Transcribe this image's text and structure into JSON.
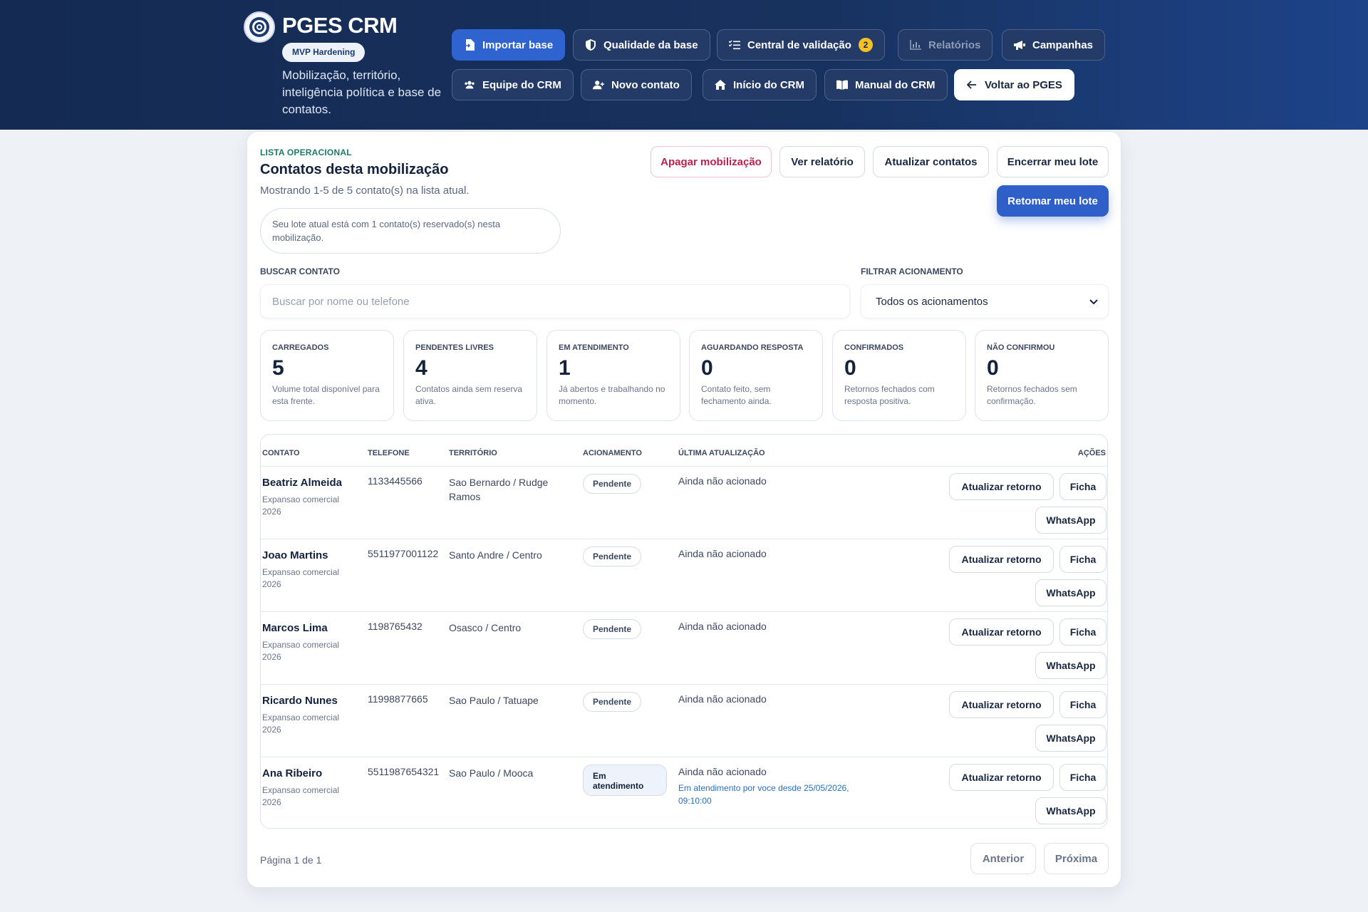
{
  "brand": {
    "title": "PGES CRM",
    "badge": "MVP Hardening",
    "subtitle": "Mobilização, território, inteligência política e base de contatos."
  },
  "nav": {
    "row1": [
      {
        "label": "Importar base",
        "icon": "file-import-icon"
      },
      {
        "label": "Qualidade da base",
        "icon": "shield-icon"
      },
      {
        "label": "Central de validação",
        "icon": "checklist-icon",
        "badge": "2"
      },
      {
        "label": "Relatórios",
        "icon": "chart-icon"
      },
      {
        "label": "Campanhas",
        "icon": "megaphone-icon"
      }
    ],
    "row2": [
      {
        "label": "Equipe do CRM",
        "icon": "users-icon"
      },
      {
        "label": "Novo contato",
        "icon": "user-plus-icon"
      },
      {
        "label": "Início do CRM",
        "icon": "home-icon"
      },
      {
        "label": "Manual do CRM",
        "icon": "book-icon"
      },
      {
        "label": "Voltar ao PGES",
        "icon": "arrow-left-icon"
      }
    ]
  },
  "list": {
    "eyebrow": "LISTA OPERACIONAL",
    "title": "Contatos desta mobilização",
    "subtitle": "Mostrando 1-5 de 5 contato(s) na lista atual.",
    "notice": "Seu lote atual está com 1 contato(s) reservado(s) nesta mobilização."
  },
  "actions": {
    "delete": "Apagar mobilização",
    "report": "Ver relatório",
    "refresh": "Atualizar contatos",
    "close_batch": "Encerrar meu lote",
    "resume_batch": "Retomar meu lote"
  },
  "filters": {
    "search_label": "BUSCAR CONTATO",
    "search_placeholder": "Buscar por nome ou telefone",
    "filter_label": "FILTRAR ACIONAMENTO",
    "filter_value": "Todos os acionamentos"
  },
  "stats": [
    {
      "label": "CARREGADOS",
      "value": "5",
      "desc": "Volume total disponível para esta frente."
    },
    {
      "label": "PENDENTES LIVRES",
      "value": "4",
      "desc": "Contatos ainda sem reserva ativa."
    },
    {
      "label": "EM ATENDIMENTO",
      "value": "1",
      "desc": "Já abertos e trabalhando no momento."
    },
    {
      "label": "AGUARDANDO RESPOSTA",
      "value": "0",
      "desc": "Contato feito, sem fechamento ainda."
    },
    {
      "label": "CONFIRMADOS",
      "value": "0",
      "desc": "Retornos fechados com resposta positiva."
    },
    {
      "label": "NÃO CONFIRMOU",
      "value": "0",
      "desc": "Retornos fechados sem confirmação."
    }
  ],
  "table": {
    "headers": {
      "contact": "CONTATO",
      "phone": "TELEFONE",
      "territory": "TERRITÓRIO",
      "status": "ACIONAMENTO",
      "updated": "ÚLTIMA ATUALIZAÇÃO",
      "actions": "AÇÕES"
    },
    "rows": [
      {
        "name": "Beatriz Almeida",
        "campaign": "Expansao comercial 2026",
        "phone": "1133445566",
        "territory": "Sao Bernardo / Rudge Ramos",
        "status": "Pendente",
        "updated": "Ainda não acionado",
        "note": ""
      },
      {
        "name": "Joao Martins",
        "campaign": "Expansao comercial 2026",
        "phone": "5511977001122",
        "territory": "Santo Andre / Centro",
        "status": "Pendente",
        "updated": "Ainda não acionado",
        "note": ""
      },
      {
        "name": "Marcos Lima",
        "campaign": "Expansao comercial 2026",
        "phone": "1198765432",
        "territory": "Osasco / Centro",
        "status": "Pendente",
        "updated": "Ainda não acionado",
        "note": ""
      },
      {
        "name": "Ricardo Nunes",
        "campaign": "Expansao comercial 2026",
        "phone": "11998877665",
        "territory": "Sao Paulo / Tatuape",
        "status": "Pendente",
        "updated": "Ainda não acionado",
        "note": ""
      },
      {
        "name": "Ana Ribeiro",
        "campaign": "Expansao comercial 2026",
        "phone": "5511987654321",
        "territory": "Sao Paulo / Mooca",
        "status": "Em atendimento",
        "updated": "Ainda não acionado",
        "note": "Em atendimento por voce desde 25/05/2026, 09:10:00"
      }
    ],
    "row_actions": {
      "update": "Atualizar retorno",
      "record": "Ficha",
      "whatsapp": "WhatsApp"
    }
  },
  "pagination": {
    "info": "Página 1 de 1",
    "prev": "Anterior",
    "next": "Próxima"
  },
  "colors": {
    "header": "#142a52",
    "primary": "#2f63cf",
    "badge": "#f5c026",
    "danger": "#c0204e",
    "eyebrow": "#1f7a6a"
  }
}
